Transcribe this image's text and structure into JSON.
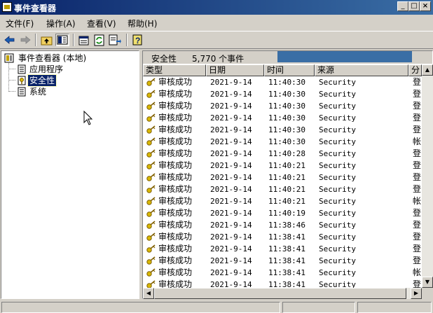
{
  "window": {
    "title": "事件查看器"
  },
  "menu": [
    "文件(F)",
    "操作(A)",
    "查看(V)",
    "帮助(H)"
  ],
  "toolbar": {
    "buttons": [
      "back-icon",
      "forward-icon",
      "up-folder-icon",
      "show-hide-tree-icon",
      "properties-icon",
      "refresh-icon",
      "export-list-icon",
      "help-icon"
    ]
  },
  "tree": {
    "root": "事件查看器 (本地)",
    "items": [
      "应用程序",
      "安全性",
      "系统"
    ],
    "selected": "安全性"
  },
  "right_pane": {
    "log_name": "安全性",
    "event_count": "5,770 个事件",
    "columns": [
      "类型",
      "日期",
      "时间",
      "来源",
      "分"
    ],
    "rows": [
      {
        "type": "审核成功",
        "date": "2021-9-14",
        "time": "11:40:30",
        "source": "Security",
        "cat": "登"
      },
      {
        "type": "审核成功",
        "date": "2021-9-14",
        "time": "11:40:30",
        "source": "Security",
        "cat": "登"
      },
      {
        "type": "审核成功",
        "date": "2021-9-14",
        "time": "11:40:30",
        "source": "Security",
        "cat": "登"
      },
      {
        "type": "审核成功",
        "date": "2021-9-14",
        "time": "11:40:30",
        "source": "Security",
        "cat": "登"
      },
      {
        "type": "审核成功",
        "date": "2021-9-14",
        "time": "11:40:30",
        "source": "Security",
        "cat": "登"
      },
      {
        "type": "审核成功",
        "date": "2021-9-14",
        "time": "11:40:30",
        "source": "Security",
        "cat": "帐"
      },
      {
        "type": "审核成功",
        "date": "2021-9-14",
        "time": "11:40:28",
        "source": "Security",
        "cat": "登"
      },
      {
        "type": "审核成功",
        "date": "2021-9-14",
        "time": "11:40:21",
        "source": "Security",
        "cat": "登"
      },
      {
        "type": "审核成功",
        "date": "2021-9-14",
        "time": "11:40:21",
        "source": "Security",
        "cat": "登"
      },
      {
        "type": "审核成功",
        "date": "2021-9-14",
        "time": "11:40:21",
        "source": "Security",
        "cat": "登"
      },
      {
        "type": "审核成功",
        "date": "2021-9-14",
        "time": "11:40:21",
        "source": "Security",
        "cat": "帐"
      },
      {
        "type": "审核成功",
        "date": "2021-9-14",
        "time": "11:40:19",
        "source": "Security",
        "cat": "登"
      },
      {
        "type": "审核成功",
        "date": "2021-9-14",
        "time": "11:38:46",
        "source": "Security",
        "cat": "登"
      },
      {
        "type": "审核成功",
        "date": "2021-9-14",
        "time": "11:38:41",
        "source": "Security",
        "cat": "登"
      },
      {
        "type": "审核成功",
        "date": "2021-9-14",
        "time": "11:38:41",
        "source": "Security",
        "cat": "登"
      },
      {
        "type": "审核成功",
        "date": "2021-9-14",
        "time": "11:38:41",
        "source": "Security",
        "cat": "登"
      },
      {
        "type": "审核成功",
        "date": "2021-9-14",
        "time": "11:38:41",
        "source": "Security",
        "cat": "帐"
      },
      {
        "type": "审核成功",
        "date": "2021-9-14",
        "time": "11:38:41",
        "source": "Security",
        "cat": "登"
      }
    ]
  },
  "colors": {
    "title_bar": "#0a246a",
    "selection": "#0a246a",
    "key_icon": "#d8b800",
    "progress": "#3a6ea5"
  }
}
